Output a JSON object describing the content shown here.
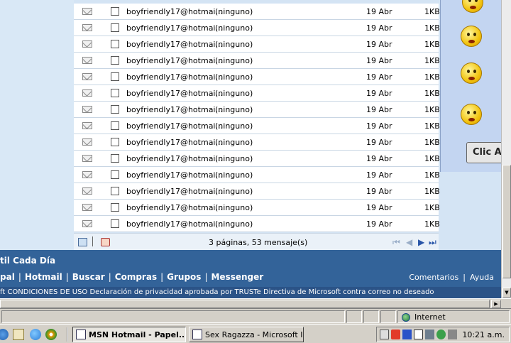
{
  "messages": [
    {
      "from": "boyfriendly17@hotmai...",
      "subject": "(ninguno)",
      "date": "19 Abr",
      "size": "1KB"
    },
    {
      "from": "boyfriendly17@hotmai...",
      "subject": "(ninguno)",
      "date": "19 Abr",
      "size": "1KB"
    },
    {
      "from": "boyfriendly17@hotmai...",
      "subject": "(ninguno)",
      "date": "19 Abr",
      "size": "1KB"
    },
    {
      "from": "boyfriendly17@hotmai...",
      "subject": "(ninguno)",
      "date": "19 Abr",
      "size": "1KB"
    },
    {
      "from": "boyfriendly17@hotmai...",
      "subject": "(ninguno)",
      "date": "19 Abr",
      "size": "1KB"
    },
    {
      "from": "boyfriendly17@hotmai...",
      "subject": "(ninguno)",
      "date": "19 Abr",
      "size": "1KB"
    },
    {
      "from": "boyfriendly17@hotmai...",
      "subject": "(ninguno)",
      "date": "19 Abr",
      "size": "1KB"
    },
    {
      "from": "boyfriendly17@hotmai...",
      "subject": "(ninguno)",
      "date": "19 Abr",
      "size": "1KB"
    },
    {
      "from": "boyfriendly17@hotmai...",
      "subject": "(ninguno)",
      "date": "19 Abr",
      "size": "1KB"
    },
    {
      "from": "boyfriendly17@hotmai...",
      "subject": "(ninguno)",
      "date": "19 Abr",
      "size": "1KB"
    },
    {
      "from": "boyfriendly17@hotmai...",
      "subject": "(ninguno)",
      "date": "19 Abr",
      "size": "1KB"
    },
    {
      "from": "boyfriendly17@hotmai...",
      "subject": "(ninguno)",
      "date": "19 Abr",
      "size": "1KB"
    },
    {
      "from": "boyfriendly17@hotmai...",
      "subject": "(ninguno)",
      "date": "19 Abr",
      "size": "1KB"
    },
    {
      "from": "boyfriendly17@hotmai...",
      "subject": "(ninguno)",
      "date": "19 Abr",
      "size": "1KB"
    }
  ],
  "list_footer": {
    "pages_text": "3 páginas, 53 mensaje(s)",
    "nav_first": "⏮",
    "nav_prev": "◀",
    "nav_next": "▶",
    "nav_last": "⏭"
  },
  "ad": {
    "button_label": "Clic Aq"
  },
  "footer": {
    "tagline": "til Cada Día",
    "links": [
      "pal",
      "Hotmail",
      "Buscar",
      "Compras",
      "Grupos",
      "Messenger"
    ],
    "separator": "|",
    "comentarios": "Comentarios",
    "ayuda": "Ayuda",
    "legal": "ft CONDICIONES DE USO  Declaración de privacidad aprobada por TRUSTe  Directiva de Microsoft contra correo no deseado"
  },
  "statusbar": {
    "zone": "Internet"
  },
  "taskbar": {
    "tasks": [
      {
        "label": "MSN Hotmail - Papel..."
      },
      {
        "label": "Sex Ragazza - Microsoft In..."
      }
    ],
    "clock": "10:21 a.m."
  },
  "colors": {
    "footer_blue": "#336399",
    "link_blue": "#2955a8"
  }
}
